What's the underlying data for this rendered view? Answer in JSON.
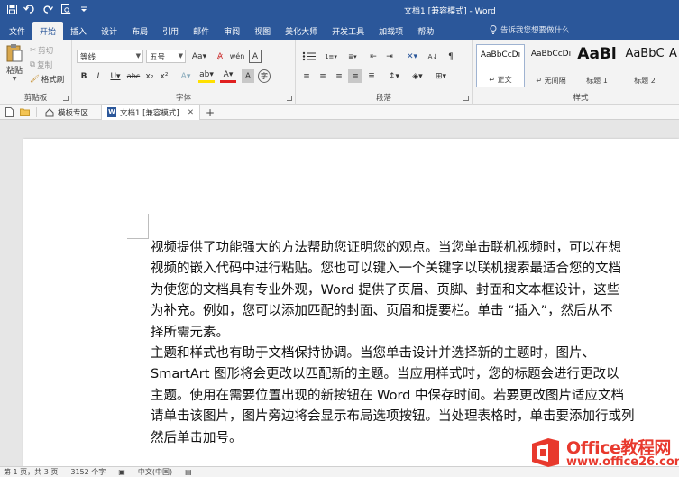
{
  "window": {
    "title": "文档1 [兼容模式] - Word"
  },
  "tabs": [
    {
      "label": "文件"
    },
    {
      "label": "开始",
      "active": true
    },
    {
      "label": "插入"
    },
    {
      "label": "设计"
    },
    {
      "label": "布局"
    },
    {
      "label": "引用"
    },
    {
      "label": "邮件"
    },
    {
      "label": "审阅"
    },
    {
      "label": "视图"
    },
    {
      "label": "美化大师"
    },
    {
      "label": "开发工具"
    },
    {
      "label": "加载项"
    },
    {
      "label": "帮助"
    }
  ],
  "tell_me": {
    "placeholder": "告诉我您想要做什么"
  },
  "clipboard": {
    "paste": "粘贴",
    "cut": "剪切",
    "copy": "复制",
    "format_painter": "格式刷",
    "group_label": "剪贴板"
  },
  "font": {
    "name": "等线",
    "size": "五号",
    "group_label": "字体"
  },
  "paragraph": {
    "group_label": "段落"
  },
  "styles": {
    "group_label": "样式",
    "items": [
      {
        "sample": "AaBbCcDı",
        "label": "↵ 正文"
      },
      {
        "sample": "AaBbCcDı",
        "label": "↵ 无间隔"
      },
      {
        "sample": "AaBl",
        "label": "标题 1"
      },
      {
        "sample": "AaBbC",
        "label": "标题 2"
      },
      {
        "sample": "A",
        "label": ""
      }
    ]
  },
  "doc_tabs": {
    "template": "模板专区",
    "document": "文档1 [兼容模式]"
  },
  "document": {
    "lines": [
      "视频提供了功能强大的方法帮助您证明您的观点。当您单击联机视频时，可以在想",
      "视频的嵌入代码中进行粘贴。您也可以键入一个关键字以联机搜索最适合您的文档",
      "为使您的文档具有专业外观，Word 提供了页眉、页脚、封面和文本框设计，这些",
      "为补充。例如，您可以添加匹配的封面、页眉和提要栏。单击 “插入”，然后从不",
      "择所需元素。",
      "主题和样式也有助于文档保持协调。当您单击设计并选择新的主题时，图片、",
      "SmartArt 图形将会更改以匹配新的主题。当应用样式时，您的标题会进行更改以",
      "主题。使用在需要位置出现的新按钮在 Word 中保存时间。若要更改图片适应文档",
      "请单击该图片，图片旁边将会显示布局选项按钮。当处理表格时，单击要添加行或列",
      "然后单击加号。"
    ]
  },
  "status": {
    "page": "第 1 页，共 3 页",
    "words": "3152 个字",
    "language": "中文(中国)"
  },
  "watermark": {
    "title": "Office教程网",
    "url": "www.office26.com"
  },
  "colors": {
    "accent": "#2b579a",
    "watermark": "#e8392d"
  }
}
